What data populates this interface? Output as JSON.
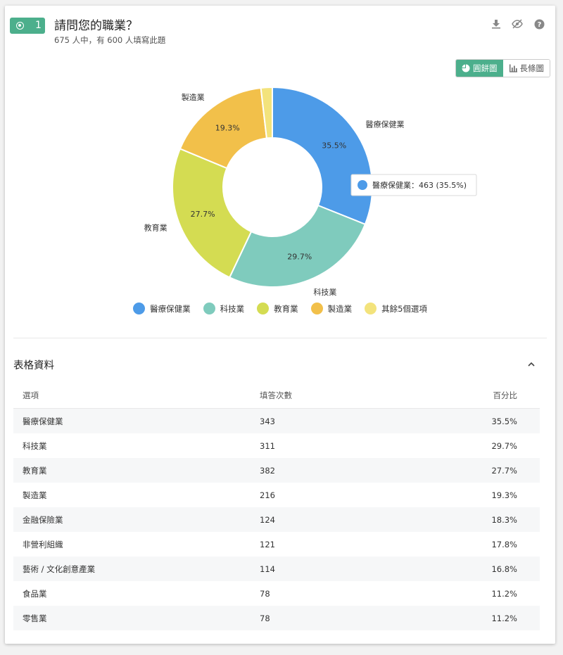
{
  "question": {
    "number": "1",
    "title": "請問您的職業？",
    "subtitle": "675 人中，有 600 人填寫此題"
  },
  "toolbar": {
    "icons": [
      "download-icon",
      "hide-icon",
      "help-icon"
    ]
  },
  "view_toggle": {
    "pie_label": "圓餅圖",
    "bar_label": "長條圖",
    "active": "pie"
  },
  "chart_data": {
    "type": "pie",
    "donut": true,
    "slices": [
      {
        "label": "醫療保健業",
        "percent": 35.5,
        "percent_label": "35.5%",
        "color": "#4d9be8"
      },
      {
        "label": "科技業",
        "percent": 29.7,
        "percent_label": "29.7%",
        "color": "#7fcbbd"
      },
      {
        "label": "教育業",
        "percent": 27.7,
        "percent_label": "27.7%",
        "color": "#d4dc52"
      },
      {
        "label": "製造業",
        "percent": 19.3,
        "percent_label": "19.3%",
        "color": "#f2c04a"
      },
      {
        "label": "其餘5個選項",
        "percent": 2.1,
        "percent_label": "",
        "color": "#f3e37c"
      }
    ],
    "tooltip": {
      "text": "醫療保健業：463 (35.5%)",
      "color": "#4d9be8"
    },
    "legend": {
      "placement": "bottom"
    }
  },
  "table": {
    "title": "表格資料",
    "columns": [
      "選項",
      "填答次數",
      "百分比"
    ],
    "rows": [
      [
        "醫療保健業",
        "343",
        "35.5%"
      ],
      [
        "科技業",
        "311",
        "29.7%"
      ],
      [
        "教育業",
        "382",
        "27.7%"
      ],
      [
        "製造業",
        "216",
        "19.3%"
      ],
      [
        "金融保險業",
        "124",
        "18.3%"
      ],
      [
        "非營利組織",
        "121",
        "17.8%"
      ],
      [
        "藝術 / 文化創意產業",
        "114",
        "16.8%"
      ],
      [
        "食品業",
        "78",
        "11.2%"
      ],
      [
        "零售業",
        "78",
        "11.2%"
      ]
    ]
  },
  "colors": {
    "accent": "#4caf8c"
  }
}
